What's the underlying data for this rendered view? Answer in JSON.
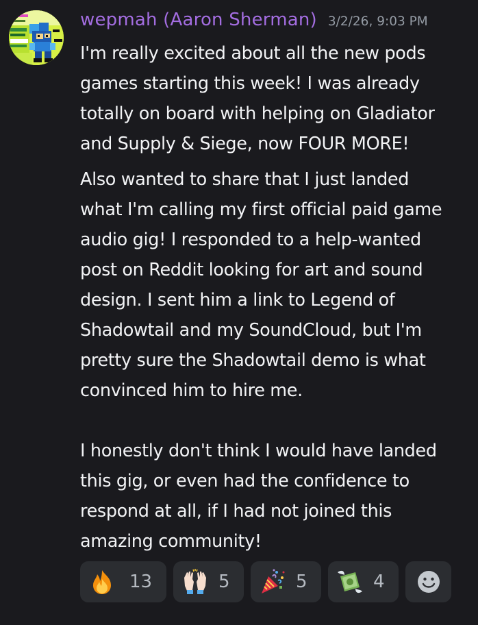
{
  "message": {
    "username": "wepmah (Aaron Sherman)",
    "timestamp": "3/2/26, 9:03 PM",
    "paragraph1": [
      "I'm really excited about all the new pods",
      "games starting this week! I was already",
      "totally on board with helping on Gladiator",
      "and Supply & Siege, now FOUR MORE!"
    ],
    "paragraph2": [
      "Also wanted to share that I just landed",
      "what I'm calling my first official paid game",
      "audio gig! I responded to a help-wanted",
      "post on Reddit looking for art and sound",
      "design. I sent him a link to Legend of",
      "Shadowtail and my SoundCloud, but I'm",
      "pretty sure the Shadowtail demo is what",
      "convinced him to hire me.",
      "",
      "I honestly don't think I would have landed",
      "this gig, or even had the confidence to",
      "respond at all, if I had not joined this",
      "amazing community!"
    ]
  },
  "reactions": [
    {
      "icon": "fire-emoji-icon",
      "count": "13"
    },
    {
      "icon": "raising-hands-emoji-icon",
      "count": "5"
    },
    {
      "icon": "party-popper-emoji-icon",
      "count": "5"
    },
    {
      "icon": "money-with-wings-emoji-icon",
      "count": "4"
    }
  ],
  "add_reaction": {
    "icon": "add-reaction-smiley-icon"
  },
  "colors": {
    "background": "#1a1a1e",
    "username": "#a36de0",
    "timestamp": "#949ba4",
    "text": "#f2f3f5",
    "reaction_bg": "#2b2d31",
    "reaction_count": "#b5bac1"
  }
}
